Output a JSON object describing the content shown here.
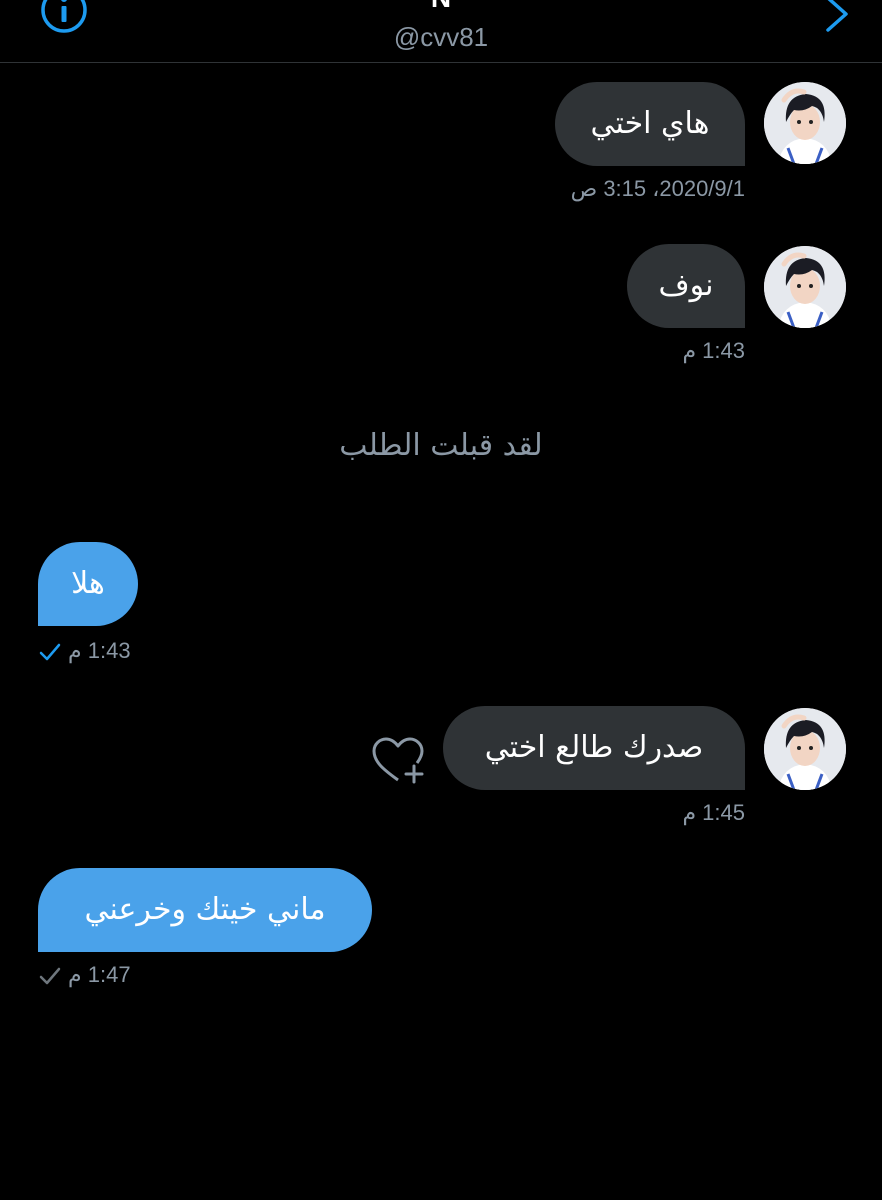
{
  "header": {
    "name": "N",
    "handle": "@cvv81",
    "info_icon": "info-icon",
    "next_icon": "chevron-right-icon"
  },
  "messages": [
    {
      "direction": "incoming",
      "text": "هاي اختي",
      "time": "2020/9/1، 3:15 ص"
    },
    {
      "direction": "incoming",
      "text": "نوف",
      "time": "1:43 م"
    },
    {
      "direction": "outgoing",
      "text": "هلا",
      "time": "1:43 م",
      "status": "seen"
    },
    {
      "direction": "incoming",
      "text": "صدرك طالع اختي",
      "time": "1:45 م"
    },
    {
      "direction": "outgoing",
      "text": "ماني خيتك وخرعني",
      "time": "1:47 م",
      "status": "sent"
    }
  ],
  "system_message": "لقد قبلت الطلب",
  "colors": {
    "background": "#000000",
    "incoming_bubble": "#2f3336",
    "outgoing_bubble": "#4aa2ea",
    "accent": "#1d9bf0",
    "muted_text": "#8b98a5"
  },
  "icons": {
    "react": "heart-plus-icon",
    "seen": "check-icon-blue",
    "sent": "check-icon-gray"
  }
}
